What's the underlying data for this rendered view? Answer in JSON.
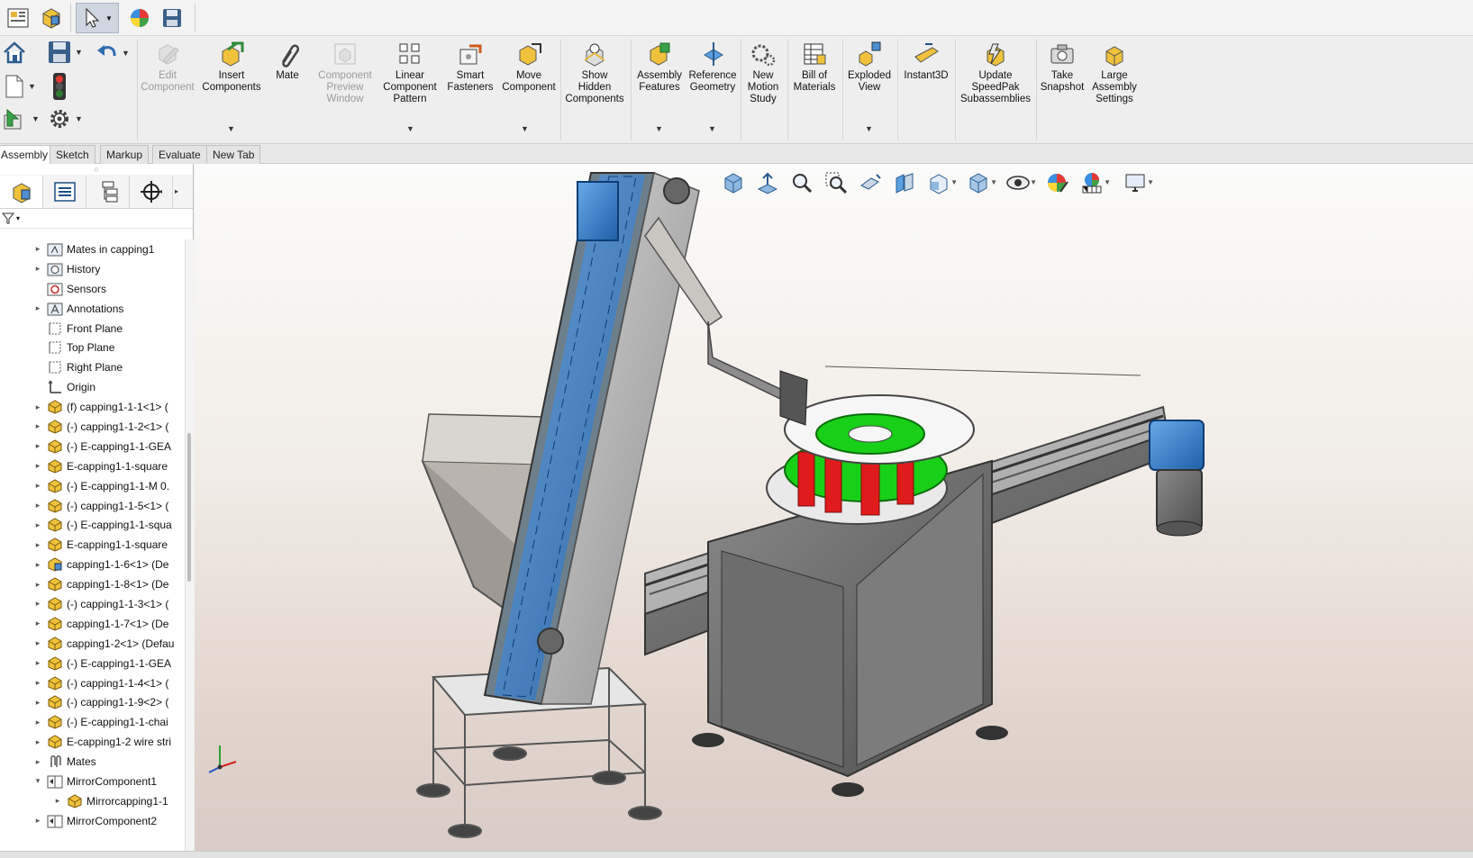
{
  "ribbon": {
    "commands": [
      {
        "label": "Edit\nComponent",
        "disabled": true
      },
      {
        "label": "Insert\nComponents",
        "disabled": false
      },
      {
        "label": "Mate",
        "disabled": false
      },
      {
        "label": "Component\nPreview\nWindow",
        "disabled": true
      },
      {
        "label": "Linear\nComponent\nPattern",
        "disabled": false
      },
      {
        "label": "Smart\nFasteners",
        "disabled": false
      },
      {
        "label": "Move\nComponent",
        "disabled": false
      },
      {
        "label": "Show\nHidden\nComponents",
        "disabled": false
      },
      {
        "label": "Assembly\nFeatures",
        "disabled": false
      },
      {
        "label": "Reference\nGeometry",
        "disabled": false
      },
      {
        "label": "New\nMotion\nStudy",
        "disabled": false
      },
      {
        "label": "Bill of\nMaterials",
        "disabled": false
      },
      {
        "label": "Exploded\nView",
        "disabled": false
      },
      {
        "label": "Instant3D",
        "disabled": false
      },
      {
        "label": "Update\nSpeedPak\nSubassemblies",
        "disabled": false
      },
      {
        "label": "Take\nSnapshot",
        "disabled": false
      },
      {
        "label": "Large\nAssembly\nSettings",
        "disabled": false
      }
    ]
  },
  "tabs": [
    "Assembly",
    "Sketch",
    "Markup",
    "Evaluate",
    "New Tab"
  ],
  "tree": {
    "items": [
      {
        "label": "Mates in capping1",
        "icon": "mates-folder-icon",
        "expand": "right"
      },
      {
        "label": "History",
        "icon": "history-icon",
        "expand": "right"
      },
      {
        "label": "Sensors",
        "icon": "sensor-icon",
        "expand": ""
      },
      {
        "label": "Annotations",
        "icon": "annotations-icon",
        "expand": "right"
      },
      {
        "label": "Front Plane",
        "icon": "plane-icon",
        "expand": ""
      },
      {
        "label": "Top Plane",
        "icon": "plane-icon",
        "expand": ""
      },
      {
        "label": "Right Plane",
        "icon": "plane-icon",
        "expand": ""
      },
      {
        "label": "Origin",
        "icon": "origin-icon",
        "expand": ""
      },
      {
        "label": "(f) capping1-1-1<1> (",
        "icon": "part-icon",
        "expand": "right"
      },
      {
        "label": "(-) capping1-1-2<1> (",
        "icon": "part-icon",
        "expand": "right"
      },
      {
        "label": "(-) E-capping1-1-GEA",
        "icon": "part-icon",
        "expand": "right"
      },
      {
        "label": "E-capping1-1-square",
        "icon": "part-icon",
        "expand": "right"
      },
      {
        "label": "(-) E-capping1-1-M 0.",
        "icon": "part-icon",
        "expand": "right"
      },
      {
        "label": "(-) capping1-1-5<1> (",
        "icon": "part-icon",
        "expand": "right"
      },
      {
        "label": "(-) E-capping1-1-squa",
        "icon": "part-icon",
        "expand": "right"
      },
      {
        "label": "E-capping1-1-square",
        "icon": "part-icon",
        "expand": "right"
      },
      {
        "label": "capping1-1-6<1> (De",
        "icon": "assembly-icon",
        "expand": "right"
      },
      {
        "label": "capping1-1-8<1> (De",
        "icon": "part-icon",
        "expand": "right"
      },
      {
        "label": "(-) capping1-1-3<1> (",
        "icon": "part-icon",
        "expand": "right"
      },
      {
        "label": "capping1-1-7<1> (De",
        "icon": "part-icon",
        "expand": "right"
      },
      {
        "label": "capping1-2<1> (Defau",
        "icon": "part-icon",
        "expand": "right"
      },
      {
        "label": "(-) E-capping1-1-GEA",
        "icon": "part-icon",
        "expand": "right"
      },
      {
        "label": "(-) capping1-1-4<1> (",
        "icon": "part-icon",
        "expand": "right"
      },
      {
        "label": "(-) capping1-1-9<2> (",
        "icon": "part-icon",
        "expand": "right"
      },
      {
        "label": "(-) E-capping1-1-chai",
        "icon": "part-icon",
        "expand": "right"
      },
      {
        "label": "E-capping1-2 wire stri",
        "icon": "part-icon",
        "expand": "right"
      },
      {
        "label": "Mates",
        "icon": "mates-icon",
        "expand": "right"
      },
      {
        "label": "MirrorComponent1",
        "icon": "mirror-folder-icon",
        "expand": "down"
      },
      {
        "label": "Mirrorcapping1-1",
        "icon": "part-icon",
        "expand": "right",
        "indent": 1
      },
      {
        "label": "MirrorComponent2",
        "icon": "mirror-folder-icon",
        "expand": "right"
      }
    ]
  }
}
